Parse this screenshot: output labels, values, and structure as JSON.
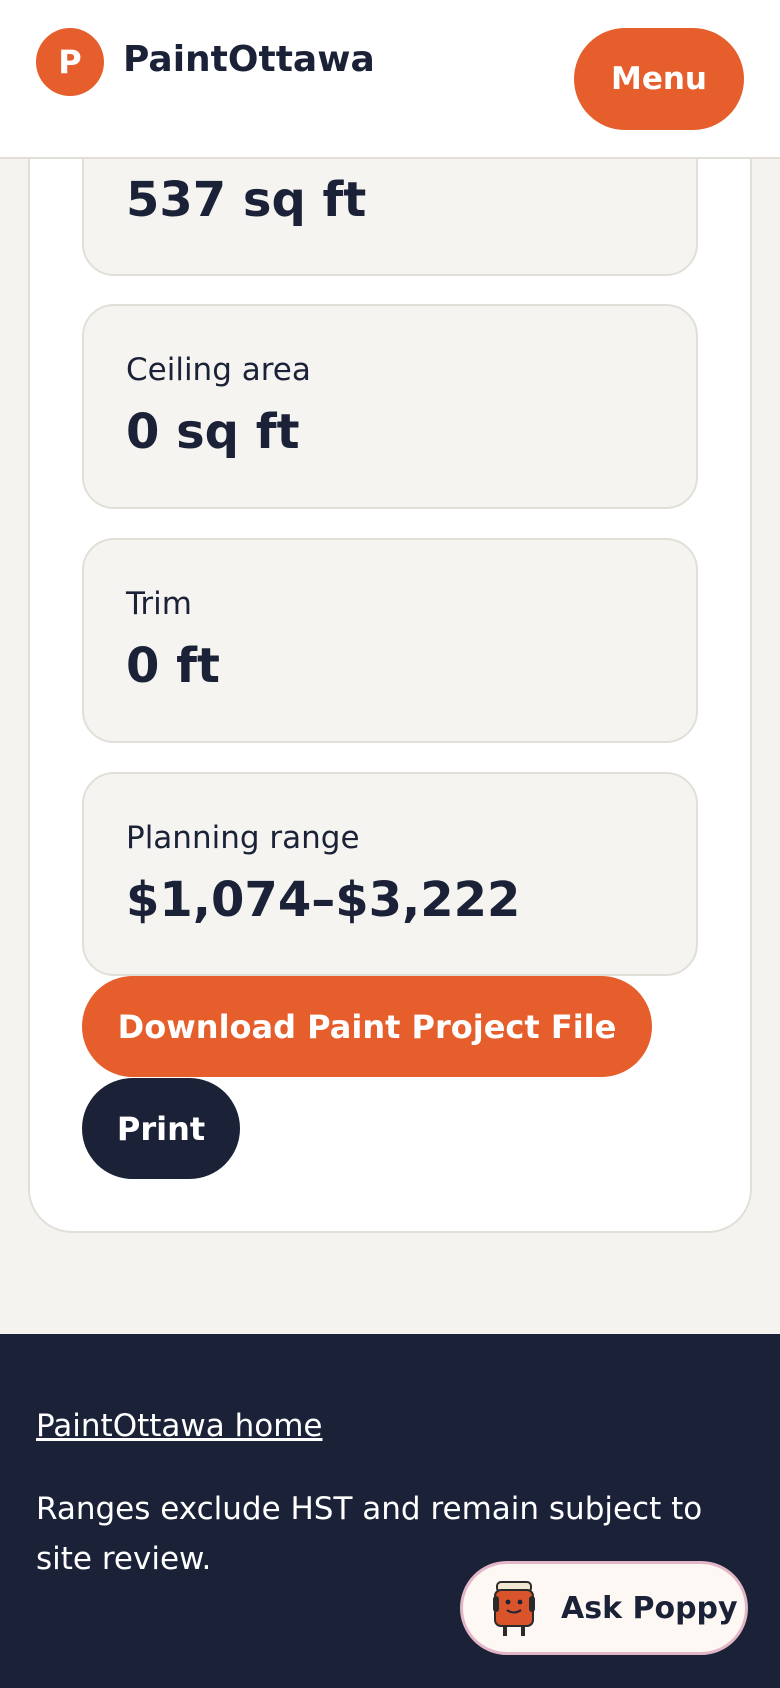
{
  "header": {
    "logo_letter": "P",
    "brand": "PaintOttawa",
    "menu_label": "Menu"
  },
  "summary": {
    "cards": [
      {
        "label": "",
        "value": "537 sq ft"
      },
      {
        "label": "Ceiling area",
        "value": "0 sq ft"
      },
      {
        "label": "Trim",
        "value": "0 ft"
      },
      {
        "label": "Planning range",
        "value": "$1,074–$3,222"
      }
    ],
    "download_label": "Download Paint Project File",
    "print_label": "Print"
  },
  "footer": {
    "home_link": "PaintOttawa home",
    "note": "Ranges exclude HST and remain subject to site review."
  },
  "chat": {
    "label": "Ask Poppy",
    "icon": "paint-can-mascot-icon"
  },
  "colors": {
    "accent": "#e55e2b",
    "navy": "#1b2238",
    "page_bg": "#f4f3f0",
    "card_bg": "#f5f4f1"
  }
}
